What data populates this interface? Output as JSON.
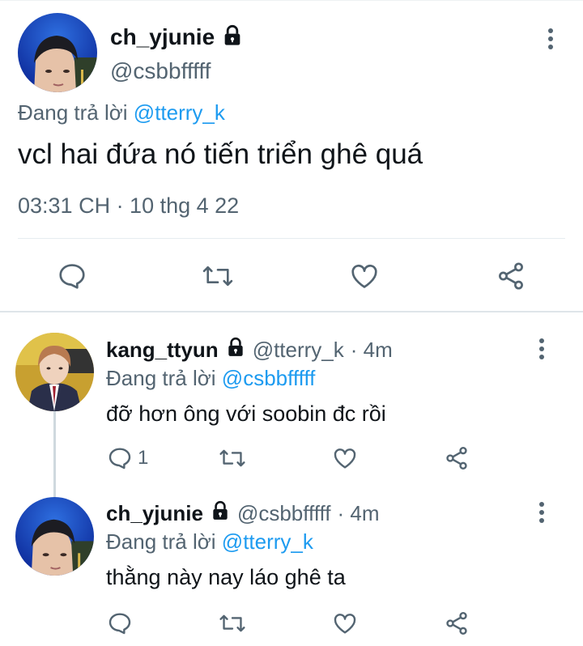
{
  "main_tweet": {
    "display_name": "ch_yjunie",
    "handle": "@csbbfffff",
    "reply_prefix": "Đang trả lời",
    "reply_to": "@tterry_k",
    "text": "vcl hai đứa nó tiến triển ghê quá",
    "timestamp": "03:31 CH · 10 thg 4 22"
  },
  "replies": [
    {
      "display_name": "kang_ttyun",
      "handle": "@tterry_k",
      "time": "· 4m",
      "reply_prefix": "Đang trả lời",
      "reply_to": "@csbbfffff",
      "text": "đỡ hơn ông với soobin đc rồi",
      "reply_count": "1"
    },
    {
      "display_name": "ch_yjunie",
      "handle": "@csbbfffff",
      "time": "· 4m",
      "reply_prefix": "Đang trả lời",
      "reply_to": "@tterry_k",
      "text": "thằng này nay láo ghê ta",
      "reply_count": ""
    }
  ],
  "icons": {
    "reply": "speech-bubble-icon",
    "retweet": "retweet-icon",
    "like": "heart-icon",
    "share": "share-icon",
    "more": "vertical-dots-icon",
    "lock": "lock-icon"
  },
  "colors": {
    "text": "#0f1419",
    "muted": "#536471",
    "accent": "#1d9bf0",
    "divider": "#e6ecf0"
  }
}
